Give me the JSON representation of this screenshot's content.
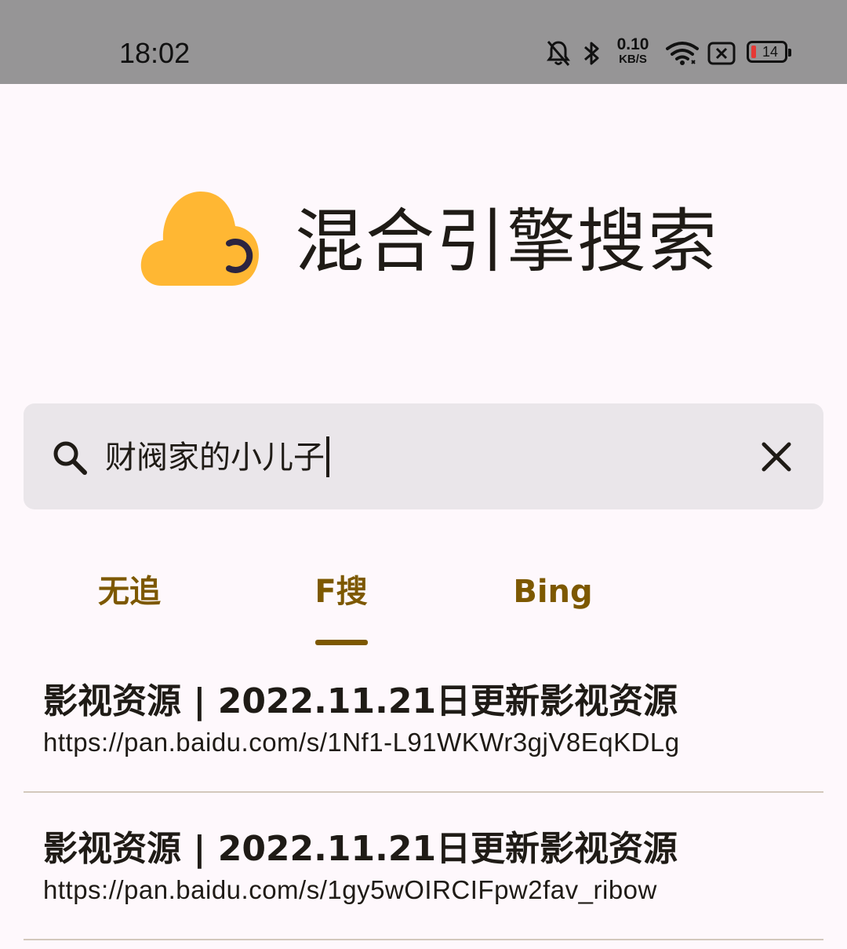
{
  "status_bar": {
    "time": "18:02",
    "net_speed_value": "0.10",
    "net_speed_unit": "KB/S",
    "battery_level": "14",
    "icons": [
      "bell-off-icon",
      "bluetooth-icon",
      "wifi-icon",
      "sim-off-icon",
      "battery-icon"
    ]
  },
  "header": {
    "logo_icon": "cloud-moon-icon",
    "title": "混合引擎搜索"
  },
  "search": {
    "query": "财阀家的小儿子",
    "search_icon": "search-icon",
    "clear_icon": "close-icon"
  },
  "tabs": [
    {
      "label": "无追",
      "selected": false
    },
    {
      "label": "F搜",
      "selected": true
    },
    {
      "label": "Bing",
      "selected": false
    }
  ],
  "results": [
    {
      "title": "影视资源 | 2022.11.21日更新影视资源",
      "url": "https://pan.baidu.com/s/1Nf1-L91WKWr3gjV8EqKDLg"
    },
    {
      "title": "影视资源 | 2022.11.21日更新影视资源",
      "url": "https://pan.baidu.com/s/1gy5wOIRCIFpw2fav_ribow"
    }
  ],
  "colors": {
    "accent": "#7D5800",
    "logo_yellow": "#FFB733",
    "status_bar_bg": "#969596",
    "search_bg": "#EAE6EA",
    "battery_low": "#E53935"
  }
}
